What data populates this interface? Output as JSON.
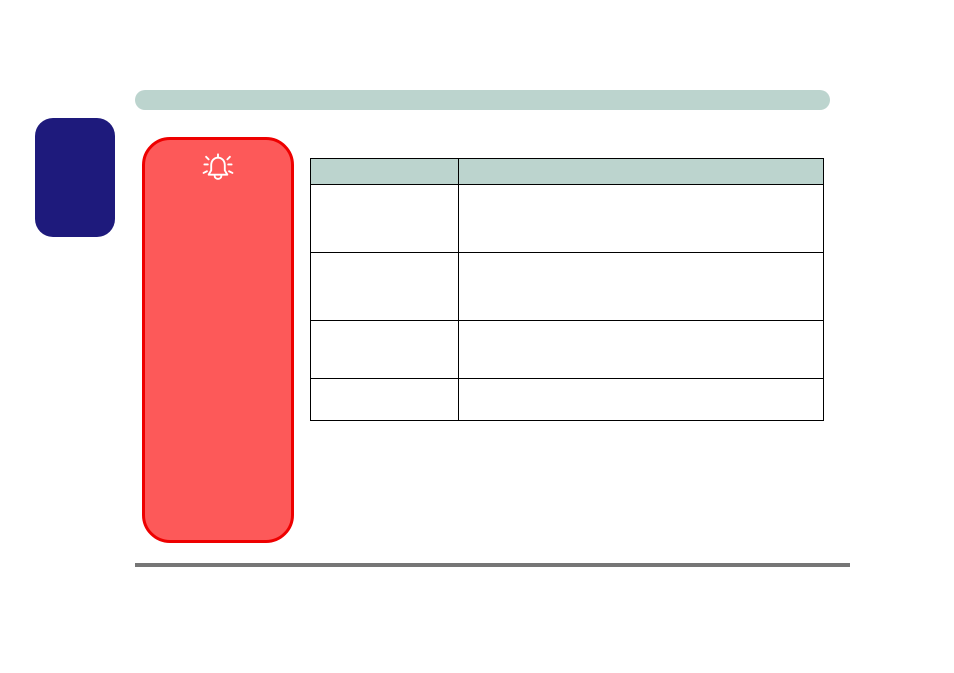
{
  "header": {
    "title": ""
  },
  "blue_box": {
    "label": ""
  },
  "red_panel": {
    "icon": "alarm-bell-icon",
    "label": ""
  },
  "table": {
    "headers": [
      "",
      ""
    ],
    "rows": [
      {
        "c1": "",
        "c2": ""
      },
      {
        "c1": "",
        "c2": ""
      },
      {
        "c1": "",
        "c2": ""
      },
      {
        "c1": "",
        "c2": ""
      }
    ]
  },
  "colors": {
    "accent_blue": "#1e1a7c",
    "panel_red": "#fd5959",
    "panel_red_border": "#ee0000",
    "header_grey": "#bcd4ce",
    "divider": "#767676"
  }
}
